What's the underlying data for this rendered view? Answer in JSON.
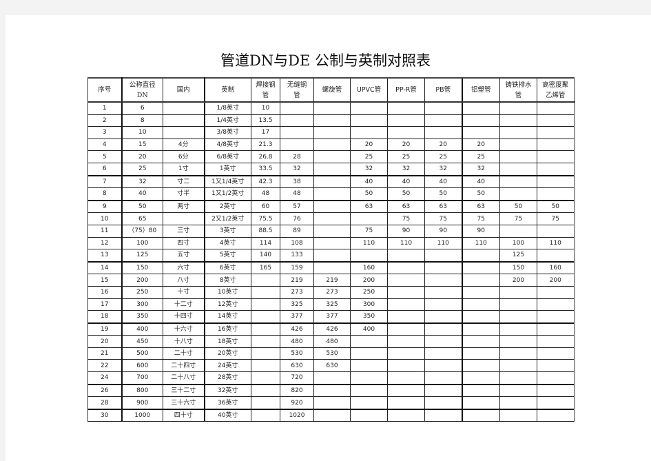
{
  "title": "管道DN与DE  公制与英制对照表",
  "table": {
    "headers": {
      "seq": "序号",
      "dn_line1": "公称直径",
      "dn_line2": "DN",
      "domestic": "国内",
      "imperial": "英制",
      "welded_line1": "焊接钢",
      "welded_line2": "管",
      "seamless_line1": "无缝钢",
      "seamless_line2": "管",
      "spiral": "螺旋管",
      "upvc": "UPVC管",
      "ppr": "PP-R管",
      "pb": "PB管",
      "alu_plastic": "铝塑管",
      "cast_iron_line1": "铸铁排水",
      "cast_iron_line2": "管",
      "hdpe_line1": "高密度聚",
      "hdpe_line2": "乙烯管"
    },
    "rows": [
      {
        "seq": "1",
        "dn": "6",
        "domestic": "",
        "imperial": "1/8英寸",
        "welded": "10",
        "seamless": "",
        "spiral": "",
        "upvc": "",
        "ppr": "",
        "pb": "",
        "alu": "",
        "cast": "",
        "hdpe": ""
      },
      {
        "seq": "2",
        "dn": "8",
        "domestic": "",
        "imperial": "1/4英寸",
        "welded": "13.5",
        "seamless": "",
        "spiral": "",
        "upvc": "",
        "ppr": "",
        "pb": "",
        "alu": "",
        "cast": "",
        "hdpe": ""
      },
      {
        "seq": "3",
        "dn": "10",
        "domestic": "",
        "imperial": "3/8英寸",
        "welded": "17",
        "seamless": "",
        "spiral": "",
        "upvc": "",
        "ppr": "",
        "pb": "",
        "alu": "",
        "cast": "",
        "hdpe": ""
      },
      {
        "seq": "4",
        "dn": "15",
        "domestic": "4分",
        "imperial": "4/8英寸",
        "welded": "21.3",
        "seamless": "",
        "spiral": "",
        "upvc": "20",
        "ppr": "20",
        "pb": "20",
        "alu": "20",
        "cast": "",
        "hdpe": ""
      },
      {
        "seq": "5",
        "dn": "20",
        "domestic": "6分",
        "imperial": "6/8英寸",
        "welded": "26.8",
        "seamless": "28",
        "spiral": "",
        "upvc": "25",
        "ppr": "25",
        "pb": "25",
        "alu": "25",
        "cast": "",
        "hdpe": ""
      },
      {
        "seq": "6",
        "dn": "25",
        "domestic": "1寸",
        "imperial": "1英寸",
        "welded": "33.5",
        "seamless": "32",
        "spiral": "",
        "upvc": "32",
        "ppr": "32",
        "pb": "32",
        "alu": "32",
        "cast": "",
        "hdpe": ""
      },
      {
        "seq": "7",
        "dn": "32",
        "domestic": "寸二",
        "imperial": "1又1/4英寸",
        "welded": "42.3",
        "seamless": "38",
        "spiral": "",
        "upvc": "40",
        "ppr": "40",
        "pb": "40",
        "alu": "40",
        "cast": "",
        "hdpe": ""
      },
      {
        "seq": "8",
        "dn": "40",
        "domestic": "寸半",
        "imperial": "1又1/2英寸",
        "welded": "48",
        "seamless": "48",
        "spiral": "",
        "upvc": "50",
        "ppr": "50",
        "pb": "50",
        "alu": "50",
        "cast": "",
        "hdpe": ""
      },
      {
        "seq": "9",
        "dn": "50",
        "domestic": "两寸",
        "imperial": "2英寸",
        "welded": "60",
        "seamless": "57",
        "spiral": "",
        "upvc": "63",
        "ppr": "63",
        "pb": "63",
        "alu": "63",
        "cast": "50",
        "hdpe": "50"
      },
      {
        "seq": "10",
        "dn": "65",
        "domestic": "",
        "imperial": "2又1/2英寸",
        "welded": "75.5",
        "seamless": "76",
        "spiral": "",
        "upvc": "",
        "ppr": "75",
        "pb": "75",
        "alu": "75",
        "cast": "75",
        "hdpe": "75"
      },
      {
        "seq": "11",
        "dn": "（75）80",
        "domestic": "三寸",
        "imperial": "3英寸",
        "welded": "88.5",
        "seamless": "89",
        "spiral": "",
        "upvc": "75",
        "ppr": "90",
        "pb": "90",
        "alu": "90",
        "cast": "",
        "hdpe": ""
      },
      {
        "seq": "12",
        "dn": "100",
        "domestic": "四寸",
        "imperial": "4英寸",
        "welded": "114",
        "seamless": "108",
        "spiral": "",
        "upvc": "110",
        "ppr": "110",
        "pb": "110",
        "alu": "110",
        "cast": "100",
        "hdpe": "110"
      },
      {
        "seq": "13",
        "dn": "125",
        "domestic": "五寸",
        "imperial": "5英寸",
        "welded": "140",
        "seamless": "133",
        "spiral": "",
        "upvc": "",
        "ppr": "",
        "pb": "",
        "alu": "",
        "cast": "125",
        "hdpe": ""
      },
      {
        "seq": "14",
        "dn": "150",
        "domestic": "六寸",
        "imperial": "6英寸",
        "welded": "165",
        "seamless": "159",
        "spiral": "",
        "upvc": "160",
        "ppr": "",
        "pb": "",
        "alu": "",
        "cast": "150",
        "hdpe": "160"
      },
      {
        "seq": "15",
        "dn": "200",
        "domestic": "八寸",
        "imperial": "8英寸",
        "welded": "",
        "seamless": "219",
        "spiral": "219",
        "upvc": "200",
        "ppr": "",
        "pb": "",
        "alu": "",
        "cast": "200",
        "hdpe": "200"
      },
      {
        "seq": "16",
        "dn": "250",
        "domestic": "十寸",
        "imperial": "10英寸",
        "welded": "",
        "seamless": "273",
        "spiral": "273",
        "upvc": "250",
        "ppr": "",
        "pb": "",
        "alu": "",
        "cast": "",
        "hdpe": ""
      },
      {
        "seq": "17",
        "dn": "300",
        "domestic": "十二寸",
        "imperial": "12英寸",
        "welded": "",
        "seamless": "325",
        "spiral": "325",
        "upvc": "300",
        "ppr": "",
        "pb": "",
        "alu": "",
        "cast": "",
        "hdpe": ""
      },
      {
        "seq": "18",
        "dn": "350",
        "domestic": "十四寸",
        "imperial": "14英寸",
        "welded": "",
        "seamless": "377",
        "spiral": "377",
        "upvc": "350",
        "ppr": "",
        "pb": "",
        "alu": "",
        "cast": "",
        "hdpe": ""
      },
      {
        "seq": "19",
        "dn": "400",
        "domestic": "十六寸",
        "imperial": "16英寸",
        "welded": "",
        "seamless": "426",
        "spiral": "426",
        "upvc": "400",
        "ppr": "",
        "pb": "",
        "alu": "",
        "cast": "",
        "hdpe": ""
      },
      {
        "seq": "20",
        "dn": "450",
        "domestic": "十八寸",
        "imperial": "18英寸",
        "welded": "",
        "seamless": "480",
        "spiral": "480",
        "upvc": "",
        "ppr": "",
        "pb": "",
        "alu": "",
        "cast": "",
        "hdpe": ""
      },
      {
        "seq": "21",
        "dn": "500",
        "domestic": "二十寸",
        "imperial": "20英寸",
        "welded": "",
        "seamless": "530",
        "spiral": "530",
        "upvc": "",
        "ppr": "",
        "pb": "",
        "alu": "",
        "cast": "",
        "hdpe": ""
      },
      {
        "seq": "22",
        "dn": "600",
        "domestic": "二十四寸",
        "imperial": "24英寸",
        "welded": "",
        "seamless": "630",
        "spiral": "630",
        "upvc": "",
        "ppr": "",
        "pb": "",
        "alu": "",
        "cast": "",
        "hdpe": ""
      },
      {
        "seq": "24",
        "dn": "700",
        "domestic": "二十八寸",
        "imperial": "28英寸",
        "welded": "",
        "seamless": "720",
        "spiral": "",
        "upvc": "",
        "ppr": "",
        "pb": "",
        "alu": "",
        "cast": "",
        "hdpe": ""
      },
      {
        "seq": "26",
        "dn": "800",
        "domestic": "三十二寸",
        "imperial": "32英寸",
        "welded": "",
        "seamless": "820",
        "spiral": "",
        "upvc": "",
        "ppr": "",
        "pb": "",
        "alu": "",
        "cast": "",
        "hdpe": ""
      },
      {
        "seq": "28",
        "dn": "900",
        "domestic": "三十六寸",
        "imperial": "36英寸",
        "welded": "",
        "seamless": "920",
        "spiral": "",
        "upvc": "",
        "ppr": "",
        "pb": "",
        "alu": "",
        "cast": "",
        "hdpe": ""
      },
      {
        "seq": "30",
        "dn": "1000",
        "domestic": "四十寸",
        "imperial": "40英寸",
        "welded": "",
        "seamless": "1020",
        "spiral": "",
        "upvc": "",
        "ppr": "",
        "pb": "",
        "alu": "",
        "cast": "",
        "hdpe": ""
      }
    ]
  }
}
